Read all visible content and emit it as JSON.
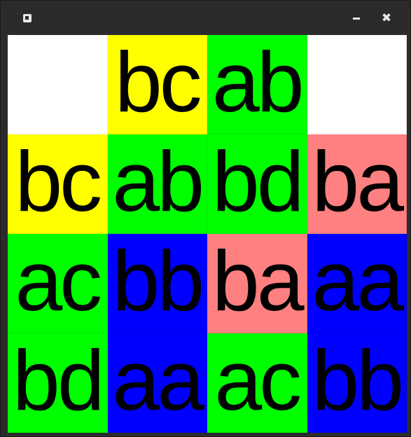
{
  "window": {
    "icon": "window-app-icon",
    "minimize_icon": "minimize-icon",
    "close_icon": "close-icon",
    "close_glyph": "✖"
  },
  "colors": {
    "white": "#ffffff",
    "yellow": "#ffff00",
    "green": "#00ff00",
    "blue": "#0000ff",
    "salmon": "#ff8080"
  },
  "board": {
    "rows": [
      [
        {
          "text": "",
          "color": "white"
        },
        {
          "text": "bc",
          "color": "yellow"
        },
        {
          "text": "ab",
          "color": "green"
        },
        {
          "text": "",
          "color": "white"
        }
      ],
      [
        {
          "text": "bc",
          "color": "yellow"
        },
        {
          "text": "ab",
          "color": "green"
        },
        {
          "text": "bd",
          "color": "green"
        },
        {
          "text": "ba",
          "color": "salmon"
        }
      ],
      [
        {
          "text": "ac",
          "color": "green"
        },
        {
          "text": "bb",
          "color": "blue"
        },
        {
          "text": "ba",
          "color": "salmon"
        },
        {
          "text": "aa",
          "color": "blue"
        }
      ],
      [
        {
          "text": "bd",
          "color": "green"
        },
        {
          "text": "aa",
          "color": "blue"
        },
        {
          "text": "ac",
          "color": "green"
        },
        {
          "text": "bb",
          "color": "blue"
        }
      ]
    ]
  }
}
